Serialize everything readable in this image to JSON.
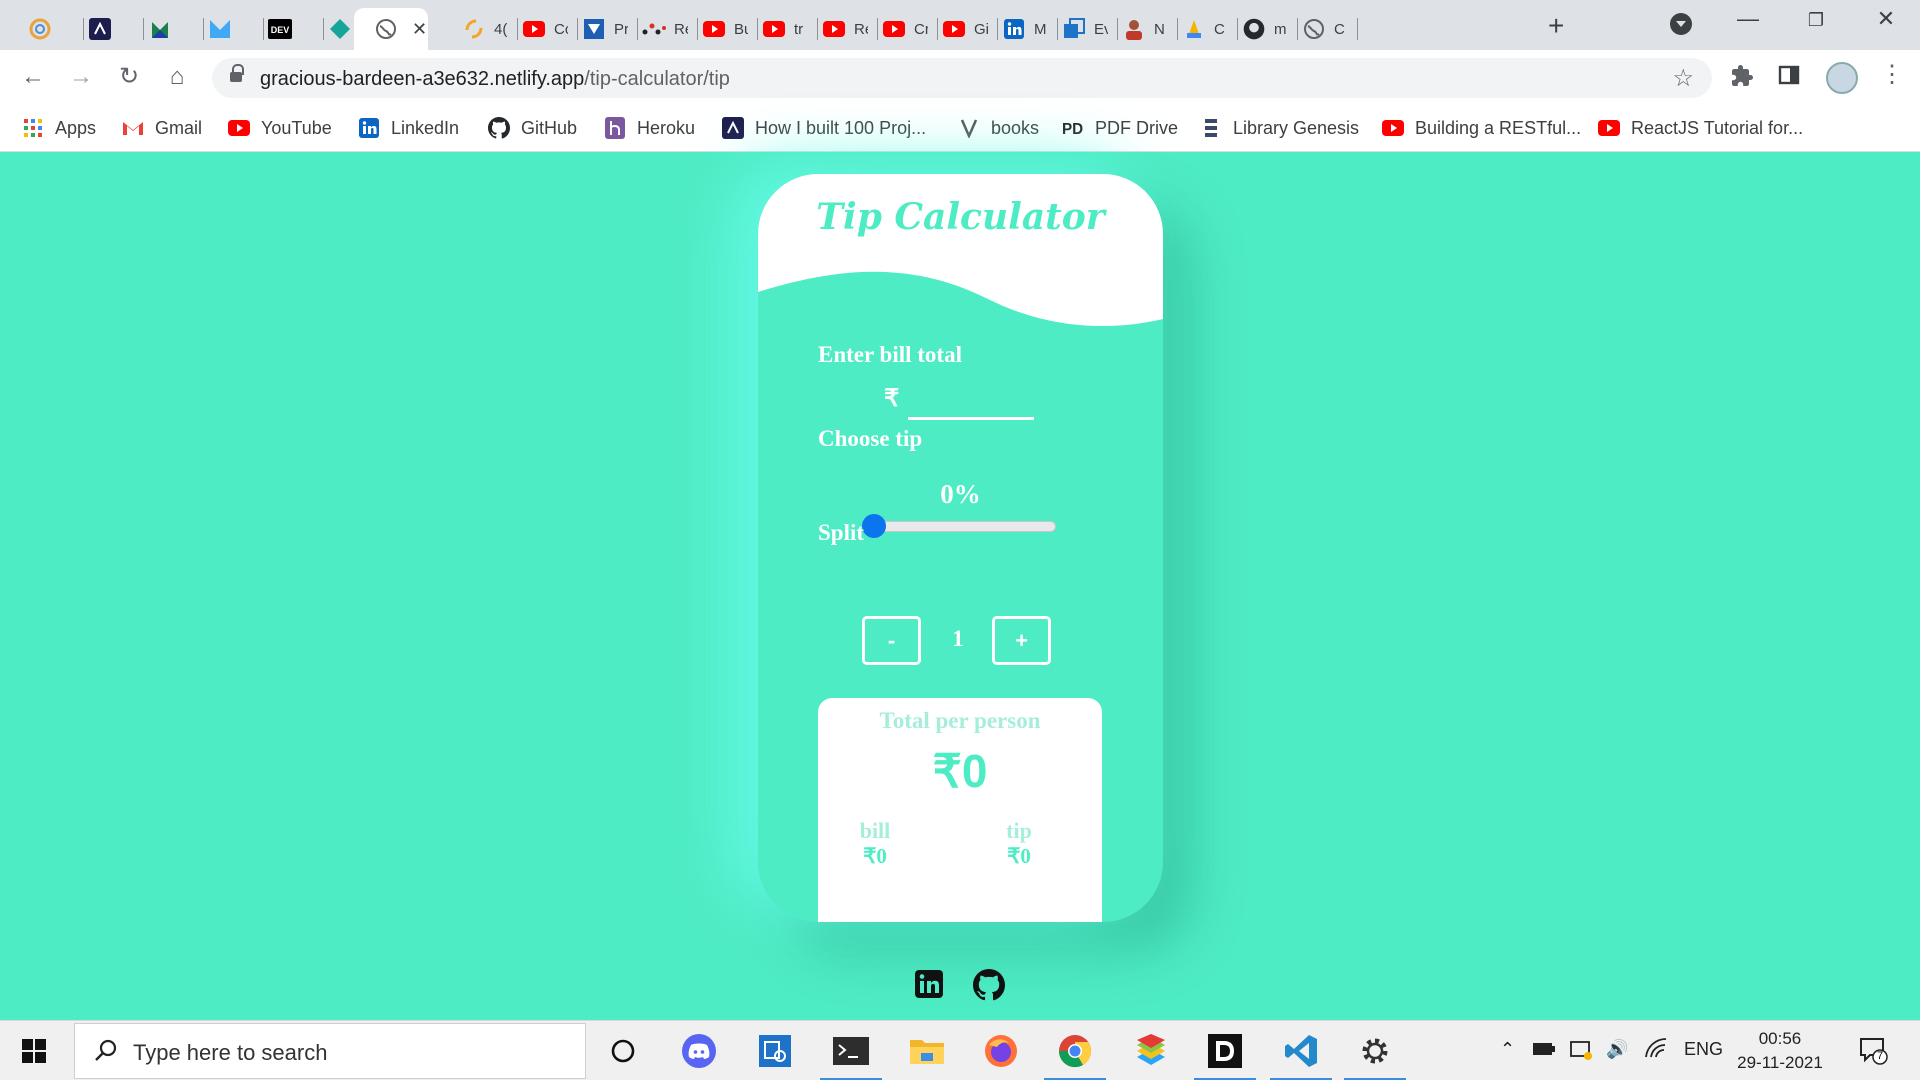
{
  "browser": {
    "tabs": [
      {
        "icon": "chrome-circle-icon",
        "title": ""
      },
      {
        "icon": "devto-logo-icon",
        "title": ""
      },
      {
        "icon": "green-k-icon",
        "title": ""
      },
      {
        "icon": "blue-m-icon",
        "title": ""
      },
      {
        "icon": "dev-badge-icon",
        "title": ""
      },
      {
        "icon": "teal-diamond-icon",
        "title": ""
      },
      {
        "icon": "globe-icon",
        "title": "",
        "active": true
      },
      {
        "icon": "orange-swirl-icon",
        "title": "4("
      },
      {
        "icon": "youtube-icon",
        "title": "Cc"
      },
      {
        "icon": "blue-shield-icon",
        "title": "Pr"
      },
      {
        "icon": "dots-icon",
        "title": "Re"
      },
      {
        "icon": "youtube-icon",
        "title": "Bu"
      },
      {
        "icon": "youtube-icon",
        "title": "tr"
      },
      {
        "icon": "youtube-icon",
        "title": "Re"
      },
      {
        "icon": "youtube-icon",
        "title": "Cr"
      },
      {
        "icon": "youtube-icon",
        "title": "Gi"
      },
      {
        "icon": "linkedin-icon",
        "title": "M"
      },
      {
        "icon": "blue-box-icon",
        "title": "Ev"
      },
      {
        "icon": "person-icon",
        "title": "N"
      },
      {
        "icon": "hands-icon",
        "title": "C"
      },
      {
        "icon": "github-icon",
        "title": "m"
      },
      {
        "icon": "globe-icon",
        "title": "C"
      }
    ],
    "url_host": "gracious-bardeen-a3e632.netlify.app",
    "url_path": "/tip-calculator/tip",
    "bookmarks": [
      {
        "label": "Apps",
        "icon": "apps-grid-icon",
        "color": "#4285f4"
      },
      {
        "label": "Gmail",
        "icon": "gmail-icon",
        "color": "#ea4335"
      },
      {
        "label": "YouTube",
        "icon": "youtube-icon",
        "color": "#ff0000"
      },
      {
        "label": "LinkedIn",
        "icon": "linkedin-icon",
        "color": "#0a66c2"
      },
      {
        "label": "GitHub",
        "icon": "github-icon",
        "color": "#24292e"
      },
      {
        "label": "Heroku",
        "icon": "heroku-icon",
        "color": "#79589f"
      },
      {
        "label": "How I built 100 Proj...",
        "icon": "devto-logo-icon",
        "color": "#1d1d4e"
      },
      {
        "label": "books",
        "icon": "v-icon",
        "color": "#555555"
      },
      {
        "label": "PDF Drive",
        "icon": "pdfdrive-icon",
        "color": "#222222"
      },
      {
        "label": "Library Genesis",
        "icon": "libgen-icon",
        "color": "#3b4a6b"
      },
      {
        "label": "Building a RESTful...",
        "icon": "youtube-icon",
        "color": "#ff0000"
      },
      {
        "label": "ReactJS Tutorial for...",
        "icon": "youtube-icon",
        "color": "#ff0000"
      }
    ]
  },
  "app": {
    "title": "Tip Calculator",
    "bill_label": "Enter bill total",
    "currency_symbol": "₹",
    "bill_value": "",
    "tip_label": "Choose tip",
    "tip_display": "0%",
    "tip_percent": 0,
    "split_label": "Split",
    "minus_label": "-",
    "plus_label": "+",
    "split_value": "1",
    "result_title": "Total per person",
    "result_total": "₹0",
    "bill_sub_label": "bill",
    "bill_sub_value": "₹0",
    "tip_sub_label": "tip",
    "tip_sub_value": "₹0",
    "accent_color": "#4eecc4"
  },
  "taskbar": {
    "search_placeholder": "Type here to search",
    "language": "ENG",
    "time": "00:56",
    "date": "29-11-2021",
    "notification_count": "7"
  }
}
